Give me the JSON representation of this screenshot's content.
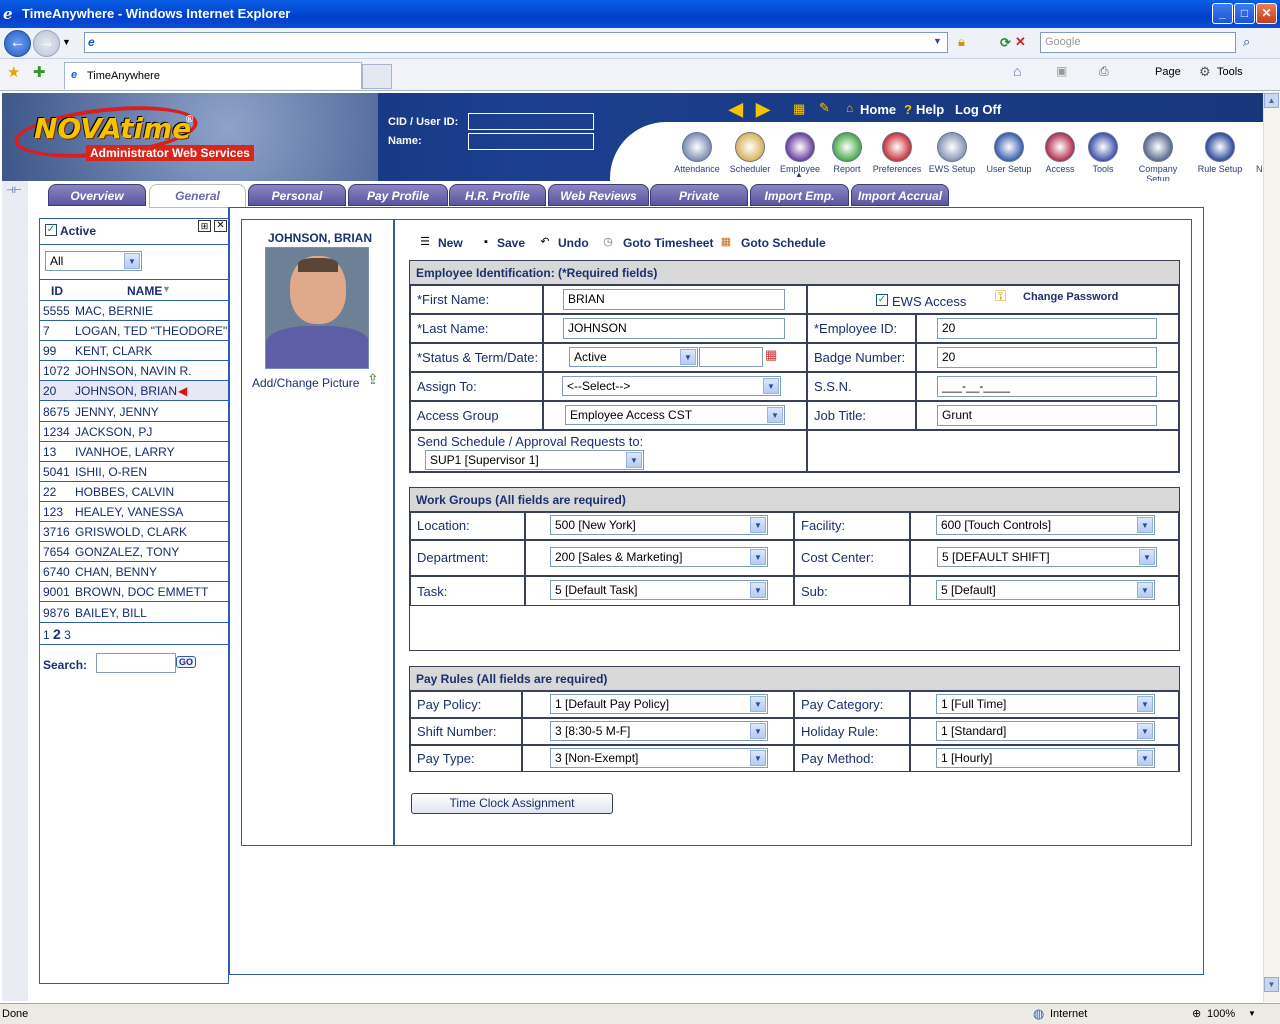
{
  "window": {
    "title": "TimeAnywhere - Windows Internet Explorer"
  },
  "browser": {
    "tab_title": "TimeAnywhere",
    "search_placeholder": "Google",
    "page_menu": "Page",
    "tools_menu": "Tools"
  },
  "header": {
    "logo_text": "NOVAtime",
    "logo_sub": "Administrator Web Services",
    "cid_label": "CID / User ID:",
    "name_label": "Name:",
    "home": "Home",
    "help": "Help",
    "logoff": "Log Off",
    "icons": [
      {
        "label": "Attendance",
        "icon": "attendance-icon",
        "color": "#7b8db5"
      },
      {
        "label": "Scheduler",
        "icon": "scheduler-icon",
        "color": "#d9b35a"
      },
      {
        "label": "Employee",
        "icon": "employee-icon",
        "color": "#6a3fa0"
      },
      {
        "label": "Report",
        "icon": "report-icon",
        "color": "#4aa84a"
      },
      {
        "label": "Preferences",
        "icon": "preferences-icon",
        "color": "#c8323a"
      },
      {
        "label": "EWS Setup",
        "icon": "ews-setup-icon",
        "color": "#8895b5"
      },
      {
        "label": "User Setup",
        "icon": "user-setup-icon",
        "color": "#3a5fb0"
      },
      {
        "label": "Access",
        "icon": "access-icon",
        "color": "#b03050"
      },
      {
        "label": "Tools",
        "icon": "tools-icon",
        "color": "#3f52a8"
      },
      {
        "label": "Company Setup",
        "icon": "company-setup-icon",
        "color": "#5a6b90"
      },
      {
        "label": "Rule Setup",
        "icon": "rule-setup-icon",
        "color": "#2f4a9c"
      },
      {
        "label": "NE",
        "icon": "next-icon",
        "color": "#e07a20"
      }
    ]
  },
  "tabs": [
    "Overview",
    "General",
    "Personal",
    "Pay Profile",
    "H.R. Profile",
    "Web Reviews",
    "Private Messages",
    "Import Emp.",
    "Import Accrual"
  ],
  "active_tab": "General",
  "employee_list": {
    "active_label": "Active",
    "filter": "All",
    "col_id": "ID",
    "col_name": "NAME",
    "rows": [
      {
        "id": "5555",
        "name": "MAC, BERNIE"
      },
      {
        "id": "7",
        "name": "LOGAN, TED \"THEODORE\""
      },
      {
        "id": "99",
        "name": "KENT, CLARK"
      },
      {
        "id": "1072",
        "name": "JOHNSON, NAVIN R."
      },
      {
        "id": "20",
        "name": "JOHNSON, BRIAN"
      },
      {
        "id": "8675",
        "name": "JENNY, JENNY"
      },
      {
        "id": "1234",
        "name": "JACKSON, PJ"
      },
      {
        "id": "13",
        "name": "IVANHOE, LARRY"
      },
      {
        "id": "5041",
        "name": "ISHII, O-REN"
      },
      {
        "id": "22",
        "name": "HOBBES, CALVIN"
      },
      {
        "id": "123",
        "name": "HEALEY, VANESSA"
      },
      {
        "id": "3716",
        "name": "GRISWOLD, CLARK"
      },
      {
        "id": "7654",
        "name": "GONZALEZ, TONY"
      },
      {
        "id": "6740",
        "name": "CHAN, BENNY"
      },
      {
        "id": "9001",
        "name": "BROWN, DOC EMMETT"
      },
      {
        "id": "9876",
        "name": "BAILEY, BILL"
      }
    ],
    "selected_id": "20",
    "pages": [
      "1",
      "2",
      "3"
    ],
    "current_page": "2",
    "search_label": "Search:",
    "go_label": "GO"
  },
  "photo": {
    "name": "JOHNSON, BRIAN",
    "change_label": "Add/Change Picture"
  },
  "toolbar": {
    "new": "New",
    "save": "Save",
    "undo": "Undo",
    "goto_timesheet": "Goto Timesheet",
    "goto_schedule": "Goto Schedule"
  },
  "identification": {
    "header": "Employee Identification:  (*Required fields)",
    "first_name_label": "*First Name:",
    "first_name": "BRIAN",
    "last_name_label": "*Last Name:",
    "last_name": "JOHNSON",
    "status_label": "*Status & Term/Date:",
    "status": "Active",
    "assign_label": "Assign To:",
    "assign": "<--Select-->",
    "access_group_label": "Access Group",
    "access_group": "Employee Access CST",
    "send_label": "Send Schedule / Approval Requests to:",
    "send": "SUP1 [Supervisor 1]",
    "ews_label": "EWS Access",
    "change_password": "Change Password",
    "emp_id_label": "*Employee ID:",
    "emp_id": "20",
    "badge_label": "Badge Number:",
    "badge": "20",
    "ssn_label": "S.S.N.",
    "ssn": "___-__-____",
    "job_label": "Job Title:",
    "job": "Grunt"
  },
  "workgroups": {
    "header": "Work Groups (All fields are required)",
    "location_label": "Location:",
    "location": "500 [New York]",
    "department_label": "Department:",
    "department": "200 [Sales & Marketing]",
    "task_label": "Task:",
    "task": "5 [Default Task]",
    "facility_label": "Facility:",
    "facility": "600 [Touch Controls]",
    "cost_label": "Cost Center:",
    "cost": "5 [DEFAULT SHIFT]",
    "sub_label": "Sub:",
    "sub": "5 [Default]"
  },
  "payrules": {
    "header": "Pay Rules (All fields are required)",
    "policy_label": "Pay Policy:",
    "policy": "1 [Default Pay Policy]",
    "shift_label": "Shift Number:",
    "shift": "3 [8:30-5 M-F]",
    "type_label": "Pay Type:",
    "type": "3 [Non-Exempt]",
    "category_label": "Pay Category:",
    "category": "1 [Full Time]",
    "holiday_label": "Holiday Rule:",
    "holiday": "1 [Standard]",
    "method_label": "Pay Method:",
    "method": "1 [Hourly]"
  },
  "time_clock_button": "Time Clock Assignment",
  "statusbar": {
    "left": "Done",
    "zone": "Internet",
    "zoom": "100%"
  }
}
